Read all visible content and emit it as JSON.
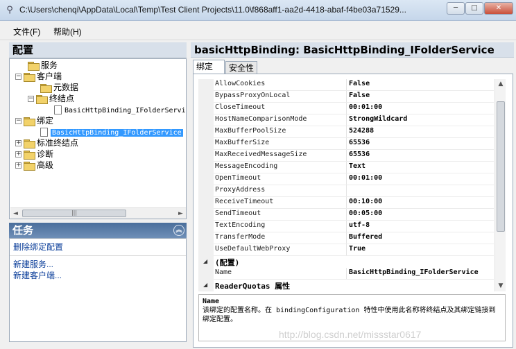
{
  "window": {
    "title": "C:\\Users\\chenqi\\AppData\\Local\\Temp\\Test Client Projects\\11.0\\f868aff1-aa2d-4418-abaf-f4be03a71529...",
    "icon": "app-icon",
    "min_label": "─",
    "max_label": "□",
    "close_label": "✕"
  },
  "menu": {
    "file": "文件(F)",
    "help": "帮助(H)"
  },
  "config": {
    "header": "配置",
    "tree": {
      "services": "服务",
      "client": "客户端",
      "metadata": "元数据",
      "endpoints": "终结点",
      "endpoint_item": "BasicHttpBinding_IFolderServi",
      "bindings": "绑定",
      "binding_item": "BasicHttpBinding_IFolderService",
      "standard_endpoints": "标准终结点",
      "diagnostics": "诊断",
      "advanced": "高级"
    },
    "scrollbar_left": "◄",
    "scrollbar_right": "►",
    "scrollbar_grip": "|||"
  },
  "tasks": {
    "header": "任务",
    "collapse_label": "︽",
    "delete_binding": "删除绑定配置",
    "new_service": "新建服务...",
    "new_client": "新建客户端..."
  },
  "binding": {
    "header": "basicHttpBinding: BasicHttpBinding_IFolderService",
    "tabs": [
      "绑定",
      "安全性"
    ],
    "properties": [
      {
        "name": "AllowCookies",
        "value": "False"
      },
      {
        "name": "BypassProxyOnLocal",
        "value": "False"
      },
      {
        "name": "CloseTimeout",
        "value": "00:01:00"
      },
      {
        "name": "HostNameComparisonMode",
        "value": "StrongWildcard"
      },
      {
        "name": "MaxBufferPoolSize",
        "value": "524288"
      },
      {
        "name": "MaxBufferSize",
        "value": "65536"
      },
      {
        "name": "MaxReceivedMessageSize",
        "value": "65536"
      },
      {
        "name": "MessageEncoding",
        "value": "Text"
      },
      {
        "name": "OpenTimeout",
        "value": "00:01:00"
      },
      {
        "name": "ProxyAddress",
        "value": ""
      },
      {
        "name": "ReceiveTimeout",
        "value": "00:10:00"
      },
      {
        "name": "SendTimeout",
        "value": "00:05:00"
      },
      {
        "name": "TextEncoding",
        "value": "utf-8"
      },
      {
        "name": "TransferMode",
        "value": "Buffered"
      },
      {
        "name": "UseDefaultWebProxy",
        "value": "True"
      }
    ],
    "category_config": "(配置)",
    "name_property": {
      "name": "Name",
      "value": "BasicHttpBinding_IFolderService"
    },
    "category_reader": "ReaderQuotas 属性",
    "collapse_glyph": "◢",
    "scroll_up": "▲",
    "scroll_down": "▼",
    "description_title": "Name",
    "description_text": "该绑定的配置名称。在 bindingConfiguration 特性中使用此名称将终结点及其绑定链接到绑定配置。"
  },
  "watermark": "http://blog.csdn.net/missstar0617"
}
